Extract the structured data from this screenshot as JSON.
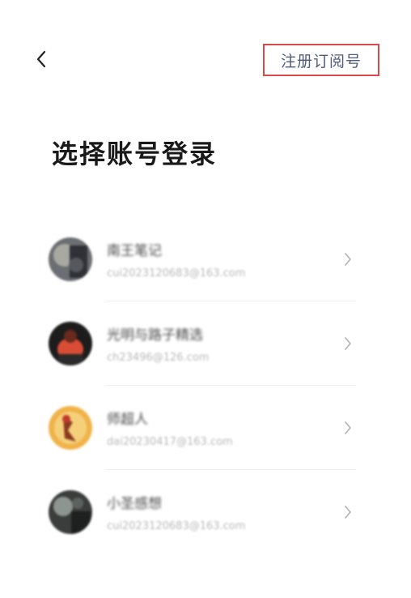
{
  "header": {
    "back_icon": "chevron-left-icon",
    "register_label": "注册订阅号",
    "register_border_color": "#d84a4a"
  },
  "title": "选择账号登录",
  "accounts": [
    {
      "name": "南王笔记",
      "email": "cui2023120683@163.com",
      "avatar_colors": [
        "#6b6e72",
        "#2f3136",
        "#a9a9a2"
      ]
    },
    {
      "name": "光明与路子精选",
      "email": "ch23496@126.com",
      "avatar_colors": [
        "#1c1c1c",
        "#d94c35",
        "#6a2a1e"
      ]
    },
    {
      "name": "师超人",
      "email": "dai20230417@163.com",
      "avatar_colors": [
        "#f0b34a",
        "#8a3a22",
        "#f5d07a"
      ]
    },
    {
      "name": "小圣感想",
      "email": "cui2023120683@163.com",
      "avatar_colors": [
        "#3a3d3c",
        "#8e9490",
        "#1e2020"
      ]
    }
  ],
  "chevron_icon": "chevron-right-icon",
  "colors": {
    "title": "#1a1a1a",
    "register_text": "#4f5b7a",
    "email": "#b8b8b8",
    "chevron": "#b0b0b0"
  }
}
